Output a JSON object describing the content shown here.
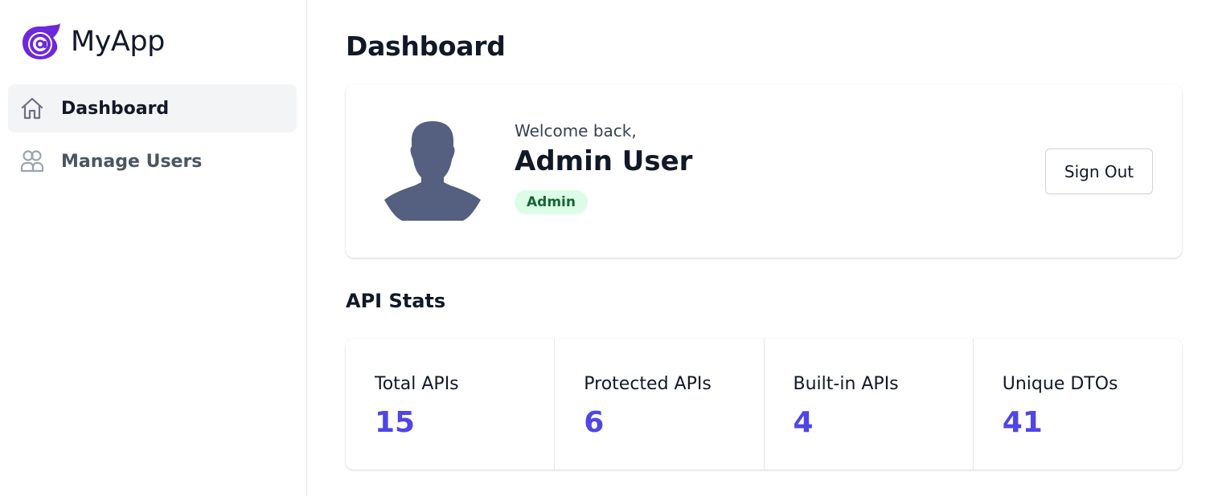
{
  "brand": {
    "name": "MyApp",
    "logo_icon": "blazor-at-icon",
    "logo_color": "#512bd4"
  },
  "sidebar": {
    "items": [
      {
        "label": "Dashboard",
        "icon": "home-icon",
        "active": true
      },
      {
        "label": "Manage Users",
        "icon": "users-icon",
        "active": false
      }
    ]
  },
  "page": {
    "title": "Dashboard"
  },
  "profile": {
    "welcome": "Welcome back,",
    "name": "Admin User",
    "role": "Admin",
    "avatar_icon": "user-silhouette-icon",
    "sign_out_label": "Sign Out"
  },
  "stats": {
    "title": "API Stats",
    "items": [
      {
        "label": "Total APIs",
        "value": "15"
      },
      {
        "label": "Protected APIs",
        "value": "6"
      },
      {
        "label": "Built-in APIs",
        "value": "4"
      },
      {
        "label": "Unique DTOs",
        "value": "41"
      }
    ]
  },
  "colors": {
    "accent": "#4f46e5",
    "badge_bg": "#dcfce7",
    "badge_text": "#166534",
    "avatar": "#556080"
  }
}
